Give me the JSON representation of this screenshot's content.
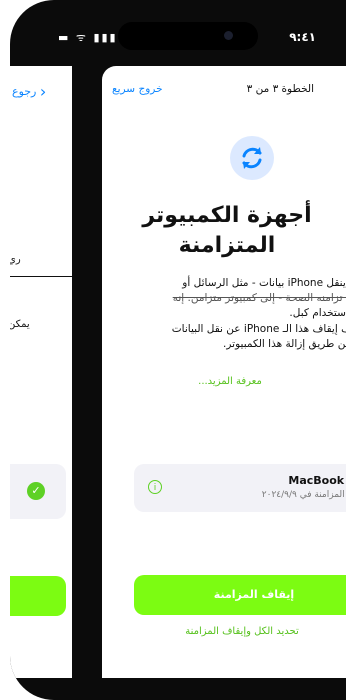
{
  "status_bar": {
    "time": "٩:٤١",
    "signal_icon": "cellular-signal-icon",
    "wifi_icon": "wifi-icon",
    "battery_icon": "battery-icon"
  },
  "left_screen": {
    "back_label": "رجوع",
    "text1": "ري",
    "text2": "يمكن",
    "check_icon": "checkmark-circle-icon"
  },
  "header": {
    "step": "الخطوة ٣ من ٣",
    "quick_exit": "خروج سريع"
  },
  "icon": "sync-arrows-icon",
  "title_line1": "أجهزة الكمبيوتر",
  "title_line2": "المتزامنة",
  "description": {
    "line1": "ا ينقل iPhone بيانات - مثل الرسائل أو",
    "line2": "يا تزامنه الصحة - إلى كمبيوتر متزامن. إنه",
    "line3": "باستخدام كبل."
  },
  "description2": {
    "line1": "ف إيقاف هذا الـ iPhone عن نقل البيانات",
    "line2": "عن طريق إزالة هذا الكمبيوتر."
  },
  "learn_more": "معرفة المزيد...",
  "device_card": {
    "name": "MacBook P",
    "subtitle": "ت المزامنة في ٢٠٢٤/٩/٩",
    "info_icon": "info-circle-icon"
  },
  "primary_button": "إيقاف المزامنة",
  "secondary_button": "تحديد الكل وإيقاف المزامنة",
  "colors": {
    "accent_green": "#7cfc12",
    "link_blue": "#0a84ff",
    "icon_bg": "#dce9ff"
  }
}
